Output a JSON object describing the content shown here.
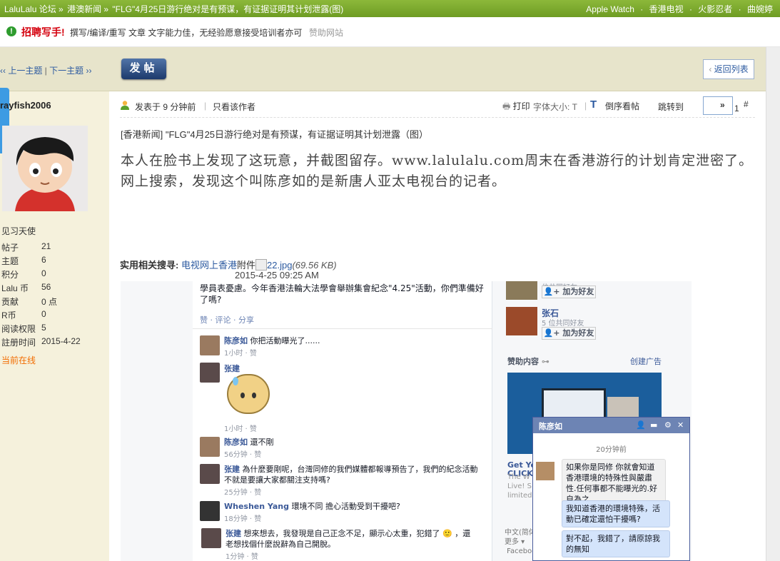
{
  "topbar": {
    "crumbs": [
      "LaluLalu 论坛 »",
      "港澳新闻 »",
      "\"FLG\"4月25日游行绝对是有预谋，有证据证明其计划泄露(图)"
    ],
    "links": [
      "Apple Watch",
      "·",
      "香港电视",
      "·",
      "火影忍者",
      "·",
      "曲婉婷"
    ]
  },
  "notice": {
    "badge": "!",
    "headline": "招聘写手!",
    "text": "撰写/编译/重写 文章 文字能力佳，无经验愿意接受培训者亦可",
    "sponsor": "赞助网站"
  },
  "toolbar": {
    "prev": "‹‹ 上一主题",
    "divider": "|",
    "next": "下一主题 ››",
    "post_button": "发帖",
    "back_button": "返回列表"
  },
  "author": {
    "name": "rayfish2006",
    "rank": "见习天使",
    "stats": [
      {
        "k": "帖子",
        "v": "21"
      },
      {
        "k": "主题",
        "v": "6"
      },
      {
        "k": "积分",
        "v": "0"
      },
      {
        "k": "Lalu 币",
        "v": "56"
      },
      {
        "k": "贡献",
        "v": "0 点"
      },
      {
        "k": "R币",
        "v": "0"
      },
      {
        "k": "阅读权限",
        "v": "5"
      },
      {
        "k": "註册时间",
        "v": "2015-4-22"
      }
    ],
    "online": "当前在线"
  },
  "post": {
    "posted": "发表于 9 分钟前",
    "sep": "|",
    "only_author": "只看该作者",
    "print": "打印",
    "font_size": "字体大小: T",
    "reverse": "倒序看帖",
    "jump": "跳转到",
    "jump_arrow": "»",
    "floor": "1",
    "floor_sign": "#",
    "title": "[香港新闻] \"FLG\"4月25日游行绝对是有预谋，有证据证明其计划泄露（图）",
    "body_line1": "本人在脸书上发现了这玩意，并截图留存。www.lalulalu.com周末在香港游行的计划肯定泄密了。",
    "body_line2": "网上搜索，发现这个叫陈彦如的是新唐人亚太电视台的记者。",
    "related_label": "实用相关搜寻:",
    "related_links": [
      "电视",
      "网上香港"
    ],
    "attach_label": "附件",
    "attach_name": "22.jpg",
    "attach_size": "(69.56 KB)",
    "attach_date": "2015-4-25 09:25 AM"
  },
  "screenshot": {
    "post_text": "學員表憂慮。今年香港法輪大法學會舉辦集會紀念\"4.25\"活動，你們準備好了嗎?",
    "post_actions": "赞 · 评论 · 分享",
    "comments": [
      {
        "name": "陈彦如",
        "text": "你把活動曝光了......",
        "time": "1小时 · 赞"
      },
      {
        "name": "张建",
        "text": "",
        "time": "1小时 · 赞"
      },
      {
        "name": "陈彦如",
        "text": "還不剛",
        "time": "56分钟 · 赞"
      },
      {
        "name": "张建",
        "text": "為什麼要剛呢，台灣同修的我們媒體都報導預告了，我們的紀念活動不就是要讓大家都關注支持嗎?",
        "time": "25分钟 · 赞"
      },
      {
        "name": "Wheshen Yang",
        "text": "環境不同 擔心活動受到干擾吧?",
        "time": "18分钟 · 赞"
      },
      {
        "name": "张建",
        "text": "想來想去，我發現是自己正念不足，顯示心太重，犯錯了 🙂 ，還老想找個什麼說辭為自己開脫。",
        "time": "1分钟 · 赞"
      }
    ],
    "friends": [
      {
        "name": "",
        "mutual": "位共同好友",
        "add": "加为好友"
      },
      {
        "name": "张石",
        "mutual": "5 位共同好友",
        "add": "加为好友"
      }
    ],
    "sponsored": "赞助内容",
    "create_ad": "创建广告",
    "ad_title": "Get Yo",
    "ad_click": "CLICK",
    "ad_text": "The W\nLive! S\nlimited",
    "lang": "中文(简体)\n更多 ▾\n Faceboo",
    "chat": {
      "name": "陈彦如",
      "time": "20分钟前",
      "messages": [
        {
          "side": "l",
          "text": "如果你是同修 你就會知道香港環境的特殊性與嚴肅性.任何事都不能曝光的.好自為之"
        },
        {
          "side": "r",
          "text": "我知道香港的環境特殊，活動已確定還怕干擾嗎?"
        },
        {
          "side": "r",
          "text": "對不起，我錯了，請原諒我的無知"
        }
      ]
    }
  }
}
